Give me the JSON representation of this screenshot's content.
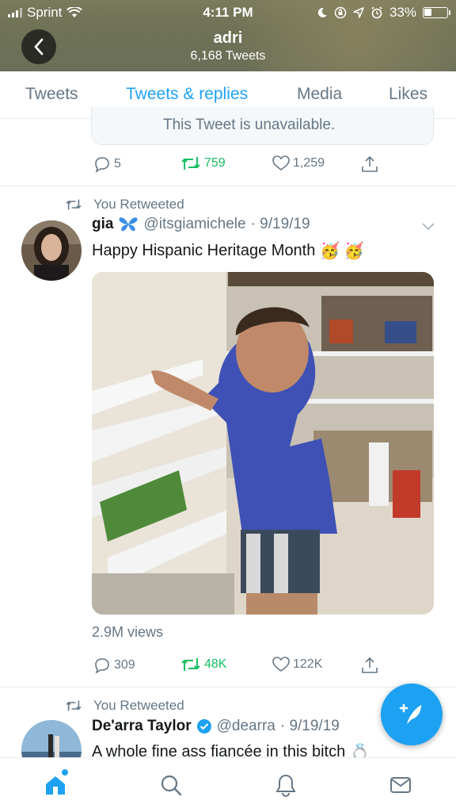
{
  "status_bar": {
    "carrier": "Sprint",
    "time": "4:11 PM",
    "battery": "33%"
  },
  "profile": {
    "name": "adri",
    "tweet_count": "6,168 Tweets"
  },
  "tabs": [
    {
      "label": "Tweets",
      "active": false
    },
    {
      "label": "Tweets & replies",
      "active": true
    },
    {
      "label": "Media",
      "active": false
    },
    {
      "label": "Likes",
      "active": false
    }
  ],
  "first_tweet": {
    "unavailable_text": "This Tweet is unavailable.",
    "replies": "5",
    "retweets": "759",
    "likes": "1,259"
  },
  "second_tweet": {
    "retweet_label": "You Retweeted",
    "name": "gia",
    "handle": "@itsgiamichele",
    "date": "· 9/19/19",
    "text": "Happy Hispanic Heritage Month",
    "emoji": "🥳 🥳",
    "views": "2.9M views",
    "replies": "309",
    "retweets": "48K",
    "likes": "122K"
  },
  "third_tweet": {
    "retweet_label": "You Retweeted",
    "name": "De'arra Taylor",
    "handle": "@dearra",
    "date": "· 9/19/19",
    "text": "A whole fine ass fiancée in this bitch",
    "emoji": "💍"
  },
  "colors": {
    "accent": "#1da1f2",
    "retweet_green": "#17bf63",
    "secondary_text": "#657786"
  },
  "icons": [
    "back-arrow-icon",
    "reply-icon",
    "retweet-icon",
    "like-icon",
    "share-icon",
    "butterfly-icon",
    "verified-icon",
    "caret-down-icon",
    "compose-icon",
    "home-icon",
    "search-icon",
    "notifications-icon",
    "messages-icon"
  ]
}
